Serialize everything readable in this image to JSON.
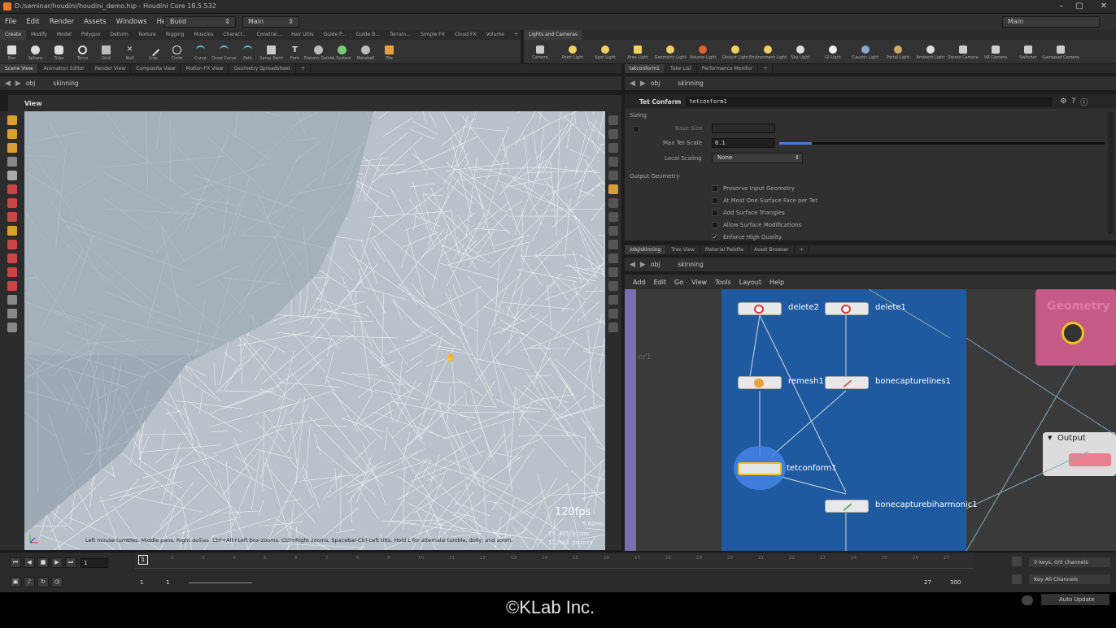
{
  "window": {
    "title": "D:/seminar/houdini/houdini_demo.hip - Houdini Core 18.5.532"
  },
  "menu": [
    "File",
    "Edit",
    "Render",
    "Assets",
    "Windows",
    "Help"
  ],
  "build_dropdown": "Build",
  "desk_dropdown": "Main",
  "desk_right": "Main",
  "shelf": {
    "tabs": [
      "Create",
      "Modify",
      "Model",
      "Polygon",
      "Deform",
      "Texture",
      "Rigging",
      "Muscles",
      "Charact...",
      "Constrai...",
      "Hair Utils",
      "Guide P...",
      "Guide B...",
      "Terrain...",
      "Simple FX",
      "Cloud FX",
      "Volume"
    ],
    "tools": [
      "Box",
      "Sphere",
      "Tube",
      "Torus",
      "Grid",
      "Null",
      "Line",
      "Circle",
      "Curve",
      "Draw Curve",
      "Path",
      "Spray Paint",
      "Font",
      "Platonic Solids",
      "L-System",
      "Metaball",
      "File"
    ]
  },
  "lights_shelf": {
    "tab": "Lights and Cameras",
    "tools": [
      "Camera",
      "Point Light",
      "Spot Light",
      "Area Light",
      "Geometry Light",
      "Volume Light",
      "Distant Light",
      "Environment Light",
      "Sky Light",
      "GI Light",
      "Caustic Light",
      "Portal Light",
      "Ambient Light",
      "Stereo Camera",
      "VR Camera",
      "Switcher",
      "Gamepad Camera"
    ]
  },
  "left_pane": {
    "tabs": [
      "Scene View",
      "Animation Editor",
      "Render View",
      "Composite View",
      "Motion FX View",
      "Geometry Spreadsheet"
    ],
    "path": [
      "obj",
      "skinning"
    ],
    "view_label": "View",
    "fps": "120fps",
    "frame_time": "5.60ms",
    "prims": "75,485",
    "prims_label": "prims",
    "points": "17,943",
    "points_label": "points",
    "hint": "Left mouse tumbles. Middle pans. Right dollies. Ctrl+Alt+Left box-zooms. Ctrl+Right zooms. Spacebar-Ctrl-Left tilts. Hold L for alternate tumble, dolly, and zoom."
  },
  "param_pane": {
    "tabs": [
      "tetconform1",
      "Take List",
      "Performance Monitor"
    ],
    "path": [
      "obj",
      "skinning"
    ],
    "node_type": "Tet Conform",
    "node_name": "tetconform1",
    "section_sizing": "Sizing",
    "base_size_label": "Base Size",
    "max_tet_scale_label": "Max Tet Scale",
    "max_tet_scale_value": "0.1",
    "max_tet_scale_fill": 0.1,
    "local_scaling_label": "Local Scaling",
    "local_scaling_value": "None",
    "section_output": "Output Geometry",
    "checkboxes": [
      {
        "label": "Preserve Input Geometry",
        "checked": false
      },
      {
        "label": "At Most One Surface Face per Tet",
        "checked": false
      },
      {
        "label": "Add Surface Triangles",
        "checked": false
      },
      {
        "label": "Allow Surface Modifications",
        "checked": false
      },
      {
        "label": "Enforce High Quality",
        "checked": true
      }
    ]
  },
  "network_pane": {
    "tabs": [
      "/obj/skinning",
      "Tree View",
      "Material Palette",
      "Asset Browser"
    ],
    "path": [
      "obj",
      "skinning"
    ],
    "menu": [
      "Add",
      "Edit",
      "Go",
      "View",
      "Tools",
      "Layout",
      "Help"
    ],
    "side_label": "er1",
    "geometry_label": "Geometry",
    "output_label": "Output",
    "nodes": {
      "delete2": "delete2",
      "delete1": "delete1",
      "remesh1": "remesh1",
      "bonecapturelines1": "bonecapturelines1",
      "tetconform1": "tetconform1",
      "bonecapturebiharmonic1": "bonecapturebiharmonic1"
    }
  },
  "timeline": {
    "current_frame": "1",
    "ticks": [
      "1",
      "2",
      "3",
      "4",
      "5",
      "6",
      "7",
      "8",
      "9",
      "10",
      "11",
      "12",
      "13",
      "14",
      "15",
      "16",
      "17",
      "18",
      "19",
      "20",
      "21",
      "22",
      "23",
      "24",
      "25",
      "26",
      "27"
    ],
    "start_a": "1",
    "start_b": "1",
    "end_a": "27",
    "end_b": "300",
    "keys_status": "0 keys, 0/0 channels",
    "key_all": "Key All Channels",
    "auto_update": "Auto Update"
  },
  "watermark": "©KLab Inc.",
  "colors": {
    "accent": "#e8792b",
    "network_box": "#1f5aa0",
    "geometry_box": "#c55a87",
    "selected": "#f0c020",
    "viewport_bg": "#9aa8b3"
  }
}
